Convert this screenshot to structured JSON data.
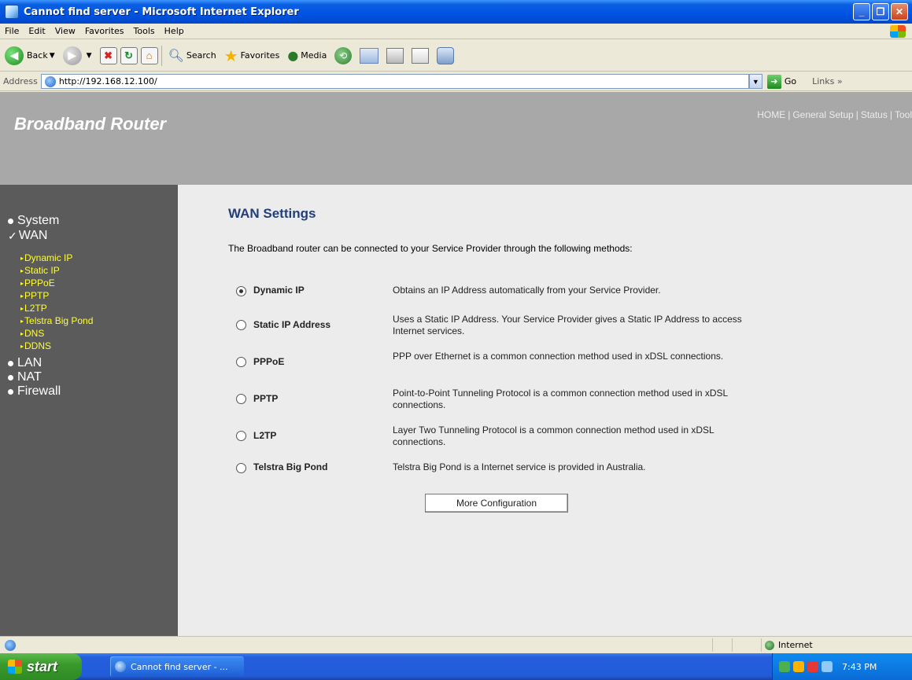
{
  "window": {
    "title": "Cannot find server - Microsoft Internet Explorer"
  },
  "menu": [
    "File",
    "Edit",
    "View",
    "Favorites",
    "Tools",
    "Help"
  ],
  "toolbar": {
    "back": "Back",
    "search": "Search",
    "favorites": "Favorites",
    "media": "Media"
  },
  "address": {
    "label": "Address",
    "url": "http://192.168.12.100/",
    "go": "Go",
    "links": "Links »"
  },
  "page": {
    "brand": "Broadband Router",
    "topnav": [
      "HOME",
      "General Setup",
      "Status",
      "Tool"
    ],
    "sidebar": {
      "system": "System",
      "wan": "WAN",
      "wan_items": [
        "Dynamic IP",
        "Static IP",
        "PPPoE",
        "PPTP",
        "L2TP",
        "Telstra Big Pond",
        "DNS",
        "DDNS"
      ],
      "lan": "LAN",
      "nat": "NAT",
      "firewall": "Firewall"
    },
    "title": "WAN Settings",
    "intro": "The Broadband router can be connected to your Service Provider through the following methods:",
    "options": [
      {
        "label": "Dynamic IP",
        "desc": "Obtains an IP Address automatically from your Service Provider.",
        "checked": true
      },
      {
        "label": "Static IP Address",
        "desc": "Uses a Static IP Address. Your Service Provider gives a Static IP Address to access Internet services.",
        "checked": false
      },
      {
        "label": "PPPoE",
        "desc": "PPP over Ethernet is a common connection method used in xDSL connections.",
        "checked": false
      },
      {
        "label": "PPTP",
        "desc": "Point-to-Point Tunneling Protocol is a common connection method used in xDSL connections.",
        "checked": false
      },
      {
        "label": "L2TP",
        "desc": "Layer Two Tunneling Protocol is a common connection method used in xDSL connections.",
        "checked": false
      },
      {
        "label": "Telstra Big Pond",
        "desc": "Telstra Big Pond is a Internet service is provided in Australia.",
        "checked": false
      }
    ],
    "more_button": "More Configuration"
  },
  "statusbar": {
    "zone": "Internet"
  },
  "taskbar": {
    "start": "start",
    "task": "Cannot find server - ...",
    "time": "7:43 PM"
  }
}
